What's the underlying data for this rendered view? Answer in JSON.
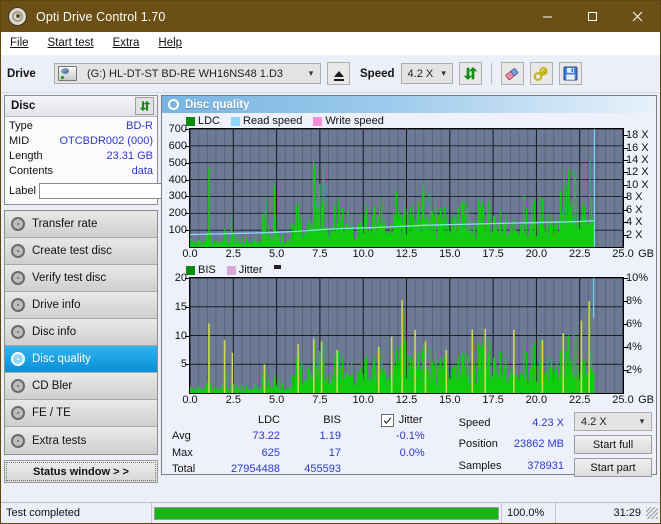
{
  "window": {
    "title": "Opti Drive Control 1.70",
    "icon": "disc-icon",
    "minimize": "–",
    "maximize": "□",
    "close": "✕"
  },
  "menu": [
    {
      "label": "File"
    },
    {
      "label": "Start test"
    },
    {
      "label": "Extra"
    },
    {
      "label": "Help"
    }
  ],
  "toolbar": {
    "drive_label": "Drive",
    "drive_value": "(G:)  HL-DT-ST BD-RE  WH16NS48 1.D3",
    "eject_icon": "eject-icon",
    "speed_label": "Speed",
    "speed_value": "4.2 X",
    "refresh_icon": "refresh-icon",
    "erase_icon": "eraser-icon",
    "tools_icon": "tools-icon",
    "save_icon": "save-icon"
  },
  "disc_panel": {
    "title": "Disc",
    "refresh_icon": "refresh-icon",
    "rows": [
      {
        "key": "Type",
        "value": "BD-R"
      },
      {
        "key": "MID",
        "value": "OTCBDR002 (000)"
      },
      {
        "key": "Length",
        "value": "23.31 GB"
      },
      {
        "key": "Contents",
        "value": "data"
      }
    ],
    "label_key": "Label",
    "label_value": "",
    "label_button_icon": "cd-icon"
  },
  "sidebar": {
    "items": [
      {
        "label": "Transfer rate",
        "selected": false
      },
      {
        "label": "Create test disc",
        "selected": false
      },
      {
        "label": "Verify test disc",
        "selected": false
      },
      {
        "label": "Drive info",
        "selected": false
      },
      {
        "label": "Disc info",
        "selected": false
      },
      {
        "label": "Disc quality",
        "selected": true
      },
      {
        "label": "CD Bler",
        "selected": false
      },
      {
        "label": "FE / TE",
        "selected": false
      },
      {
        "label": "Extra tests",
        "selected": false
      }
    ],
    "status_window": "Status window > >"
  },
  "panel": {
    "title": "Disc quality",
    "icon": "disc-icon"
  },
  "chart_data": [
    {
      "type": "area",
      "name": "ldc-chart",
      "legend": [
        {
          "label": "LDC",
          "color": "#0a8a0a"
        },
        {
          "label": "Read speed",
          "color": "#8fd8f8"
        },
        {
          "label": "Write speed",
          "color": "#f58fd8"
        }
      ],
      "legend_position": "top-left",
      "xlabel": "GB",
      "x_ticks": [
        "0.0",
        "2.5",
        "5.0",
        "7.5",
        "10.0",
        "12.5",
        "15.0",
        "17.5",
        "20.0",
        "22.5",
        "25.0"
      ],
      "xlim": [
        0,
        25
      ],
      "ylabel_left": "LDC",
      "y_ticks_left": [
        "700",
        "600",
        "500",
        "400",
        "300",
        "200",
        "100"
      ],
      "ylim_left": [
        0,
        700
      ],
      "ylabel_right": "Speed",
      "y_ticks_right": [
        "18 X",
        "16 X",
        "14 X",
        "12 X",
        "10 X",
        "8 X",
        "6 X",
        "4 X",
        "2 X"
      ],
      "ylim_right": [
        0,
        19
      ],
      "grid": true,
      "plot_bg": "#6c7a96",
      "series": [
        {
          "name": "LDC",
          "color": "#12cc12",
          "x": [
            0.05,
            0.2,
            0.35,
            0.5,
            0.65,
            0.8,
            0.95,
            1.05,
            1.1,
            1.2,
            1.35,
            1.5,
            1.65,
            1.8,
            1.95,
            2.1,
            2.25,
            2.4,
            2.5,
            2.6,
            2.75,
            2.9,
            3.05,
            3.2,
            3.35,
            3.5,
            3.65,
            3.8,
            3.95,
            4.1,
            4.25,
            4.4,
            4.55,
            4.7,
            4.85,
            5.0,
            5.15,
            5.3,
            5.45,
            5.6,
            5.75,
            5.9,
            6.05,
            6.2,
            6.35,
            6.5,
            6.65,
            6.8,
            6.95,
            7.1,
            7.25,
            7.4,
            7.55,
            7.7,
            7.85,
            8.0,
            8.15,
            8.3,
            8.45,
            8.6,
            8.75,
            8.9,
            9.05,
            9.2,
            9.35,
            9.5,
            9.65,
            9.8,
            9.95,
            10.1,
            10.25,
            10.4,
            10.55,
            10.7,
            10.85,
            11.0,
            11.15,
            11.3,
            11.45,
            11.6,
            11.75,
            11.9,
            12.05,
            12.2,
            12.35,
            12.5,
            12.65,
            12.8,
            12.95,
            13.1,
            13.25,
            13.4,
            13.55,
            13.7,
            13.85,
            14.0,
            14.15,
            14.3,
            14.45,
            14.6,
            14.75,
            14.9,
            15.05,
            15.2,
            15.35,
            15.5,
            15.65,
            15.8,
            15.95,
            16.1,
            16.25,
            16.4,
            16.55,
            16.7,
            16.85,
            17.0,
            17.15,
            17.3,
            17.45,
            17.6,
            17.75,
            17.9,
            18.05,
            18.2,
            18.35,
            18.5,
            18.65,
            18.8,
            18.95,
            19.1,
            19.25,
            19.4,
            19.55,
            19.7,
            19.85,
            20.0,
            20.15,
            20.3,
            20.45,
            20.6,
            20.75,
            20.9,
            21.05,
            21.2,
            21.35,
            21.5,
            21.65,
            21.8,
            21.95,
            22.1,
            22.25,
            22.4,
            22.55,
            22.7,
            22.85,
            23.0,
            23.15,
            23.3
          ],
          "values": [
            55,
            60,
            50,
            65,
            58,
            52,
            70,
            585,
            120,
            60,
            55,
            62,
            58,
            50,
            215,
            80,
            60,
            430,
            75,
            58,
            66,
            60,
            55,
            62,
            70,
            58,
            60,
            64,
            55,
            62,
            420,
            180,
            90,
            70,
            440,
            120,
            85,
            75,
            80,
            95,
            70,
            150,
            240,
            330,
            210,
            160,
            200,
            180,
            250,
            510,
            420,
            330,
            460,
            470,
            230,
            190,
            220,
            250,
            300,
            280,
            240,
            260,
            230,
            250,
            200,
            210,
            230,
            195,
            205,
            215,
            300,
            330,
            280,
            260,
            310,
            280,
            250,
            230,
            240,
            260,
            420,
            330,
            260,
            300,
            280,
            260,
            250,
            230,
            240,
            250,
            270,
            400,
            520,
            350,
            300,
            260,
            280,
            260,
            240,
            250,
            230,
            260,
            240,
            250,
            230,
            240,
            260,
            280,
            250,
            270,
            300,
            280,
            260,
            290,
            270,
            300,
            280,
            260,
            270,
            290,
            270,
            250,
            260,
            280,
            260,
            240,
            250,
            270,
            250,
            440,
            300,
            270,
            250,
            260,
            280,
            270,
            300,
            290,
            270,
            260,
            280,
            300,
            320,
            340,
            570,
            480,
            430,
            450,
            500,
            460,
            430,
            390,
            370,
            350,
            620,
            540,
            470,
            440,
            430
          ]
        },
        {
          "name": "Read speed",
          "color": "#8fd8f8",
          "x": [
            0.0,
            1.5,
            3.0,
            4.5,
            6.0,
            7.5,
            9.0,
            10.5,
            12.0,
            13.5,
            15.0,
            16.5,
            18.0,
            19.5,
            21.0,
            22.5,
            23.35
          ],
          "values": [
            2.0,
            2.1,
            2.2,
            2.3,
            2.5,
            2.8,
            3.0,
            3.1,
            3.3,
            3.5,
            3.6,
            3.7,
            3.8,
            3.9,
            4.0,
            4.1,
            4.25
          ]
        }
      ]
    },
    {
      "type": "area",
      "name": "bis-chart",
      "legend": [
        {
          "label": "BIS",
          "color": "#0a8a0a"
        },
        {
          "label": "Jitter",
          "color": "#d8a8d8"
        }
      ],
      "legend_position": "top-left",
      "xlabel": "GB",
      "x_ticks": [
        "0.0",
        "2.5",
        "5.0",
        "7.5",
        "10.0",
        "12.5",
        "15.0",
        "17.5",
        "20.0",
        "22.5",
        "25.0"
      ],
      "xlim": [
        0,
        25
      ],
      "ylabel_left": "BIS",
      "y_ticks_left": [
        "20",
        "15",
        "10",
        "5"
      ],
      "ylim_left": [
        0,
        20
      ],
      "ylabel_right": "Jitter",
      "y_ticks_right": [
        "10%",
        "8%",
        "6%",
        "4%",
        "2%"
      ],
      "ylim_right": [
        0,
        10
      ],
      "grid": true,
      "plot_bg": "#6c7a96",
      "series": [
        {
          "name": "BIS",
          "color": "#12cc12",
          "x": [
            0.05,
            0.2,
            0.35,
            0.5,
            0.65,
            0.8,
            0.95,
            1.05,
            1.1,
            1.2,
            1.35,
            1.5,
            1.65,
            1.8,
            1.95,
            2.1,
            2.25,
            2.4,
            2.5,
            2.6,
            2.75,
            2.9,
            3.05,
            3.2,
            3.35,
            3.5,
            3.65,
            3.8,
            3.95,
            4.1,
            4.25,
            4.4,
            4.55,
            4.7,
            4.85,
            5.0,
            5.15,
            5.3,
            5.45,
            5.6,
            5.75,
            5.9,
            6.05,
            6.2,
            6.35,
            6.5,
            6.65,
            6.8,
            6.95,
            7.1,
            7.25,
            7.4,
            7.55,
            7.7,
            7.85,
            8.0,
            8.15,
            8.3,
            8.45,
            8.6,
            8.75,
            8.9,
            9.05,
            9.2,
            9.35,
            9.5,
            9.65,
            9.8,
            9.95,
            10.1,
            10.25,
            10.4,
            10.55,
            10.7,
            10.85,
            11.0,
            11.15,
            11.3,
            11.45,
            11.6,
            11.75,
            11.9,
            12.05,
            12.2,
            12.35,
            12.5,
            12.65,
            12.8,
            12.95,
            13.1,
            13.25,
            13.4,
            13.55,
            13.7,
            13.85,
            14.0,
            14.15,
            14.3,
            14.45,
            14.6,
            14.75,
            14.9,
            15.05,
            15.2,
            15.35,
            15.5,
            15.65,
            15.8,
            15.95,
            16.1,
            16.25,
            16.4,
            16.55,
            16.7,
            16.85,
            17.0,
            17.15,
            17.3,
            17.45,
            17.6,
            17.75,
            17.9,
            18.05,
            18.2,
            18.35,
            18.5,
            18.65,
            18.8,
            18.95,
            19.1,
            19.25,
            19.4,
            19.55,
            19.7,
            19.85,
            20.0,
            20.15,
            20.3,
            20.45,
            20.6,
            20.75,
            20.9,
            21.05,
            21.2,
            21.35,
            21.5,
            21.65,
            21.8,
            21.95,
            22.1,
            22.25,
            22.4,
            22.55,
            22.7,
            22.85,
            23.0,
            23.15,
            23.3
          ],
          "values": [
            1.2,
            1.5,
            1.3,
            1.6,
            1.4,
            1.2,
            1.8,
            12.1,
            2.0,
            1.4,
            1.3,
            1.5,
            1.4,
            1.2,
            9.2,
            2.1,
            1.5,
            7.0,
            1.8,
            1.4,
            1.6,
            1.5,
            1.3,
            1.5,
            1.7,
            1.4,
            1.5,
            1.6,
            1.3,
            1.5,
            5.0,
            3.0,
            2.0,
            1.7,
            3.5,
            2.2,
            2.0,
            1.8,
            1.9,
            2.2,
            1.8,
            3.2,
            5.5,
            8.5,
            6.0,
            4.5,
            5.5,
            5.0,
            6.5,
            9.5,
            8.0,
            6.5,
            9.0,
            8.5,
            6.0,
            5.5,
            6.0,
            6.5,
            7.5,
            7.0,
            6.5,
            6.8,
            6.2,
            6.8,
            5.8,
            6.0,
            6.3,
            5.6,
            5.9,
            6.1,
            7.5,
            8.0,
            7.2,
            6.8,
            8.0,
            7.2,
            6.5,
            6.2,
            6.4,
            6.8,
            9.8,
            8.0,
            7.0,
            16.2,
            13.0,
            8.0,
            6.8,
            6.2,
            6.5,
            6.8,
            7.0,
            9.0,
            11.0,
            8.5,
            7.5,
            6.8,
            7.2,
            6.8,
            6.4,
            6.6,
            6.2,
            6.8,
            6.4,
            6.6,
            6.2,
            6.4,
            6.8,
            7.2,
            6.6,
            7.0,
            11.0,
            9.0,
            8.0,
            9.5,
            8.6,
            11.2,
            9.8,
            8.4,
            9.0,
            9.6,
            9.0,
            8.2,
            8.6,
            9.2,
            8.6,
            8.0,
            8.2,
            8.8,
            8.2,
            11.0,
            9.0,
            8.4,
            8.0,
            8.2,
            8.8,
            8.4,
            9.2,
            9.0,
            8.4,
            8.2,
            8.8,
            9.2,
            9.8,
            10.4,
            12.6,
            10.6,
            9.5,
            9.8,
            11.0,
            10.2,
            9.5,
            8.8,
            8.4,
            8.0,
            13.8,
            16.0,
            12.0,
            10.0,
            9.5
          ]
        },
        {
          "name": "Jitter",
          "color": "#cfd84a",
          "x": [
            0.05,
            1.05,
            1.95,
            2.4,
            4.25,
            6.2,
            7.1,
            7.55,
            8.45,
            10.85,
            11.6,
            12.2,
            12.95,
            13.55,
            14.75,
            16.25,
            17.0,
            18.65,
            20.3,
            21.5,
            22.55,
            23.0
          ],
          "values": [
            0,
            12.1,
            9.2,
            7.0,
            5.0,
            8.5,
            9.5,
            9.0,
            7.5,
            8.0,
            9.8,
            16.2,
            11.0,
            9.0,
            7.5,
            11.0,
            11.2,
            11.0,
            9.2,
            10.4,
            12.6,
            16.0
          ]
        }
      ]
    }
  ],
  "stats": {
    "col_headers": [
      "LDC",
      "BIS"
    ],
    "rows": [
      {
        "label": "Avg",
        "ldc": "73.22",
        "bis": "1.19",
        "jitter": "-0.1%"
      },
      {
        "label": "Max",
        "ldc": "625",
        "bis": "17",
        "jitter": "0.0%"
      },
      {
        "label": "Total",
        "ldc": "27954488",
        "bis": "455593",
        "jitter": ""
      }
    ],
    "jitter_label": "Jitter",
    "jitter_checked": true,
    "right": [
      {
        "label": "Speed",
        "value": "4.23 X"
      },
      {
        "label": "Position",
        "value": "23862 MB"
      },
      {
        "label": "Samples",
        "value": "378931"
      }
    ],
    "speed_select": "4.2 X",
    "start_full": "Start full",
    "start_part": "Start part"
  },
  "statusbar": {
    "message": "Test completed",
    "progress_percent": 100,
    "percent_label": "100.0%",
    "elapsed": "31:29"
  }
}
